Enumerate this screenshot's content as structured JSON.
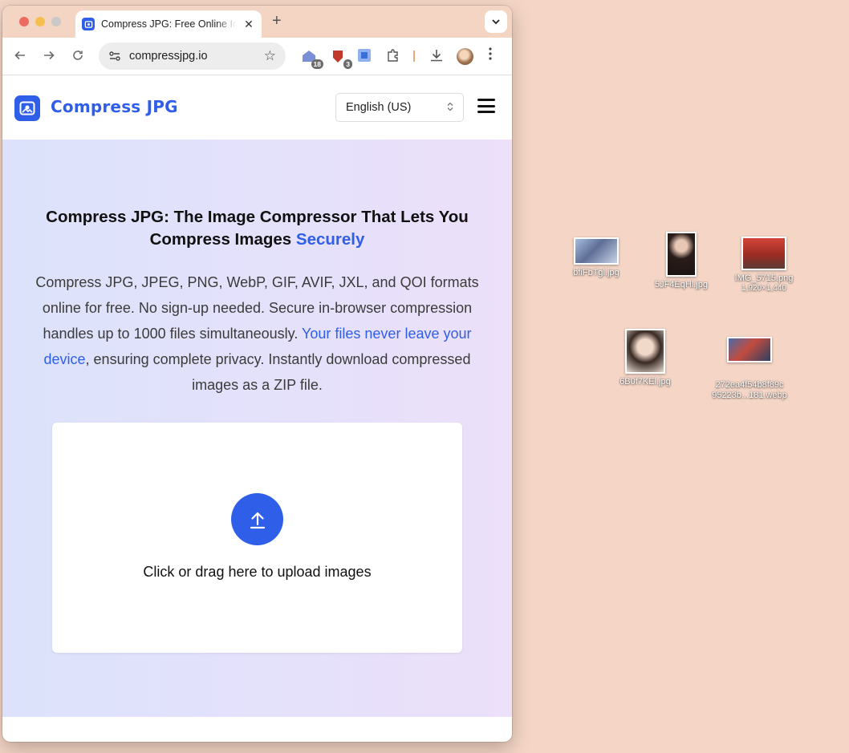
{
  "browser": {
    "tab_title": "Compress JPG: Free Online Image Compressor",
    "tab_close": "✕",
    "new_tab": "+",
    "url": "compressjpg.io",
    "extension_badges": [
      "18",
      "3"
    ]
  },
  "site": {
    "logo_text": "Compress JPG",
    "language": "English (US)"
  },
  "hero": {
    "title_main": "Compress JPG: The Image Compressor That Lets You Compress Images ",
    "title_accent": "Securely",
    "desc_part1": "Compress JPG, JPEG, PNG, WebP, GIF, AVIF, JXL, and QOI formats online for free. No sign-up needed. Secure in-browser compression handles up to 1000 files simultaneously. ",
    "desc_link": "Your files never leave your device",
    "desc_part2": ", ensuring complete privacy. Instantly download compressed images as a ZIP file.",
    "upload_text": "Click or drag here to upload images"
  },
  "desktop": {
    "files": [
      {
        "name": "bfiFbTgl.jpg",
        "sub": ""
      },
      {
        "name": "5JF4EqHl.jpg",
        "sub": ""
      },
      {
        "name": "IMG_5715.png",
        "sub": "1,920×1,440"
      },
      {
        "name": "6B0f7KEl.jpg",
        "sub": ""
      },
      {
        "name": "272ea4f54b8f89c",
        "sub": "95223b...181.webp"
      }
    ]
  },
  "colors": {
    "accent": "#2f5fe8",
    "desktop_bg": "#f5d6c6"
  }
}
